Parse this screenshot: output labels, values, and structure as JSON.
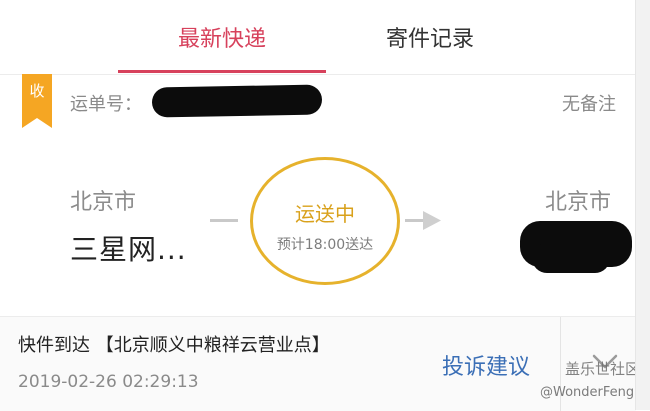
{
  "tabs": [
    {
      "label": "最新快递",
      "active": true
    },
    {
      "label": "寄件记录",
      "active": false
    }
  ],
  "colors": {
    "accent": "#d7415c",
    "badge": "#f5a623",
    "status": "#e6b22c",
    "link": "#3b6fb6"
  },
  "shipment": {
    "badge_label": "收",
    "waybill_label": "运单号：",
    "remark": "无备注",
    "from_city": "北京市",
    "from_place": "三星网...",
    "to_city": "北京市",
    "status": "运送中",
    "eta": "预计18:00送达"
  },
  "footer": {
    "latest_event": "快件到达 【北京顺义中粮祥云营业点】",
    "event_time": "2019-02-26 02:29:13",
    "complaint_label": "投诉建议"
  },
  "watermark": {
    "main": "盖乐世社区",
    "user": "@WonderFeng"
  }
}
